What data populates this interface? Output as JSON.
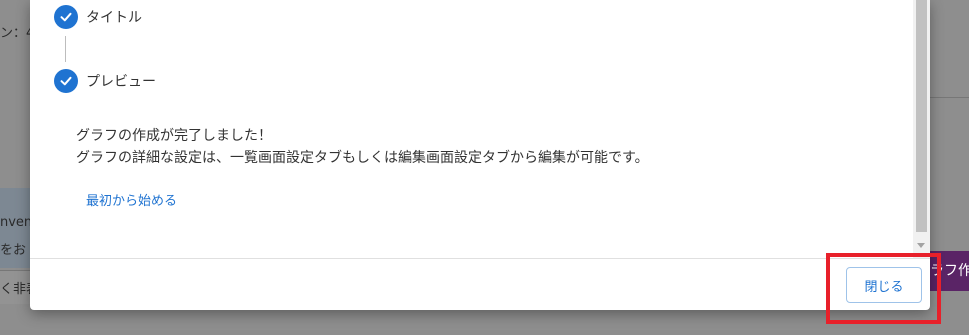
{
  "background": {
    "left_text": "ン：4...",
    "snippet_1": "nvent",
    "snippet_2": "をお",
    "snippet_3": "く非表",
    "right_button": "ラフ作"
  },
  "dialog": {
    "steps": [
      {
        "label": "タイトル",
        "icon": "check-icon"
      },
      {
        "label": "プレビュー",
        "icon": "check-icon"
      }
    ],
    "message_line1": "グラフの作成が完了しました！",
    "message_line2": "グラフの詳細な設定は、一覧画面設定タブもしくは編集画面設定タブから編集が可能です。",
    "restart_link": "最初から始める",
    "close_button": "閉じる"
  },
  "colors": {
    "accent": "#1f73d1",
    "highlight": "#e8202a"
  }
}
